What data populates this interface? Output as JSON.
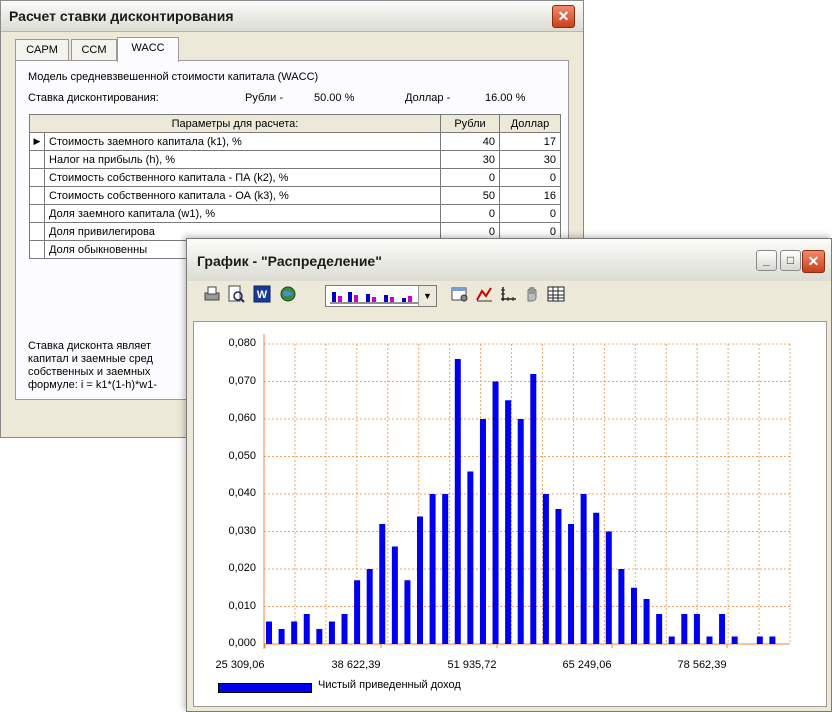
{
  "window_wacc": {
    "title": "Расчет ставки дисконтирования",
    "close_glyph": "✕",
    "tabs": [
      {
        "label": "CAPM",
        "active": false
      },
      {
        "label": "CCM",
        "active": false
      },
      {
        "label": "WACC",
        "active": true
      }
    ],
    "model_title": "Модель средневзвешенной стоимости капитала (WACC)",
    "rate_label": "Ставка дисконтирования:",
    "rub_label": "Рубли -",
    "rub_value": "50.00 %",
    "usd_label": "Доллар -",
    "usd_value": "16.00 %",
    "table": {
      "headers": [
        "Параметры для расчета:",
        "Рубли",
        "Доллар"
      ],
      "current_row_marker": "▶",
      "rows": [
        {
          "param": "Стоимость заемного капитала (k1), %",
          "rub": "40",
          "usd": "17"
        },
        {
          "param": "Налог на прибыль (h), %",
          "rub": "30",
          "usd": "30"
        },
        {
          "param": "Стоимость собственного капитала - ПА (k2), %",
          "rub": "0",
          "usd": "0"
        },
        {
          "param": "Стоимость собственного капитала - ОА (k3), %",
          "rub": "50",
          "usd": "16"
        },
        {
          "param": "Доля заемного капитала (w1), %",
          "rub": "0",
          "usd": "0"
        },
        {
          "param": "Доля привилегирова",
          "rub": "0",
          "usd": "0"
        },
        {
          "param": "Доля обыкновенны",
          "rub": "",
          "usd": ""
        }
      ]
    },
    "bottom_text": [
      "Ставка дисконта являет",
      "капитал и заемные сред",
      "собственных и заемных",
      "формуле: i = k1*(1-h)*w1-"
    ]
  },
  "window_chart": {
    "title": "График - \"Распределение\"",
    "min_glyph": "_",
    "max_glyph": "□",
    "close_glyph": "✕",
    "toolbar": {
      "print_icon": "print-icon",
      "preview_icon": "print-preview-icon",
      "word_icon": "word-export-icon",
      "web_icon": "web-export-icon",
      "combo_value": "bar-chart-type",
      "settings_icon": "chart-settings-icon",
      "trend_icon": "trend-icon",
      "axis_icon": "axis-icon",
      "hand_icon": "hand-icon",
      "table_icon": "table-icon"
    }
  },
  "chart_data": {
    "type": "bar",
    "title": "",
    "xlabel": "",
    "ylabel": "",
    "ylim": [
      0,
      0.08
    ],
    "yticks": [
      "0,000",
      "0,010",
      "0,020",
      "0,030",
      "0,040",
      "0,050",
      "0,060",
      "0,070",
      "0,080"
    ],
    "xticks": [
      "25 309,06",
      "38 622,39",
      "51 935,72",
      "65 249,06",
      "78 562,39"
    ],
    "grid": true,
    "legend_position": "bottom-left",
    "series": [
      {
        "name": "Чистый приведенный доход",
        "color": "#0000ee",
        "values": [
          0.006,
          0.004,
          0.006,
          0.008,
          0.004,
          0.006,
          0.008,
          0.017,
          0.02,
          0.032,
          0.026,
          0.017,
          0.034,
          0.04,
          0.04,
          0.076,
          0.046,
          0.06,
          0.07,
          0.065,
          0.06,
          0.072,
          0.04,
          0.036,
          0.032,
          0.04,
          0.035,
          0.03,
          0.02,
          0.015,
          0.012,
          0.008,
          0.002,
          0.008,
          0.008,
          0.002,
          0.008,
          0.002,
          0.0,
          0.002,
          0.002
        ]
      }
    ]
  }
}
